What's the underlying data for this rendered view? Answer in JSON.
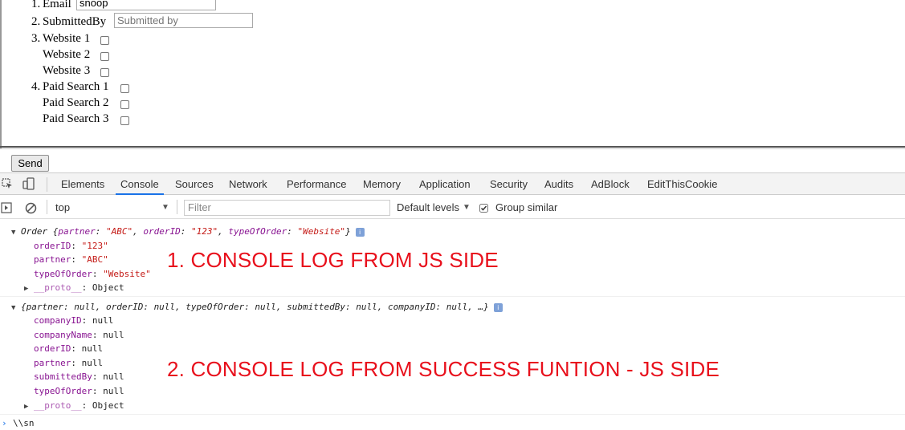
{
  "form": {
    "items": [
      {
        "num": "1.",
        "label": "Email",
        "value": "snoop"
      },
      {
        "num": "2.",
        "label": "SubmittedBy",
        "placeholder": "Submitted by"
      },
      {
        "num": "3.",
        "label": "Website 1"
      },
      {
        "num": "",
        "label": "Website 2"
      },
      {
        "num": "",
        "label": "Website 3"
      },
      {
        "num": "4.",
        "label": "Paid Search 1"
      },
      {
        "num": "",
        "label": "Paid Search 2"
      },
      {
        "num": "",
        "label": "Paid Search 3"
      }
    ],
    "send_label": "Send"
  },
  "devtools": {
    "tabs": [
      "Elements",
      "Console",
      "Sources",
      "Network",
      "Performance",
      "Memory",
      "Application",
      "Security",
      "Audits",
      "AdBlock",
      "EditThisCookie"
    ],
    "active_tab": "Console",
    "toolbar": {
      "context": "top",
      "filter_placeholder": "Filter",
      "levels": "Default levels",
      "group_similar": "Group similar"
    }
  },
  "console": {
    "entry1": {
      "summary_prefix": "Order ",
      "summary_open": "{",
      "summary_pairs": [
        {
          "key": "partner",
          "value": "\"ABC\""
        },
        {
          "key": "orderID",
          "value": "\"123\""
        },
        {
          "key": "typeOfOrder",
          "value": "\"Website\""
        }
      ],
      "summary_close": "}",
      "props": [
        {
          "key": "orderID",
          "value": "\"123\""
        },
        {
          "key": "partner",
          "value": "\"ABC\""
        },
        {
          "key": "typeOfOrder",
          "value": "\"Website\""
        }
      ],
      "proto_key": "__proto__",
      "proto_value": "Object"
    },
    "entry2": {
      "summary": "{partner: null, orderID: null, typeOfOrder: null, submittedBy: null, companyID: null, …}",
      "props": [
        {
          "key": "companyID",
          "value": "null"
        },
        {
          "key": "companyName",
          "value": "null"
        },
        {
          "key": "orderID",
          "value": "null"
        },
        {
          "key": "partner",
          "value": "null"
        },
        {
          "key": "submittedBy",
          "value": "null"
        },
        {
          "key": "typeOfOrder",
          "value": "null"
        }
      ],
      "proto_key": "__proto__",
      "proto_value": "Object"
    },
    "prompt_text": "\\\\sn"
  },
  "annotations": {
    "first": "1. CONSOLE LOG FROM JS SIDE",
    "second": "2. CONSOLE LOG FROM SUCCESS FUNTION - JS SIDE"
  },
  "colors": {
    "annotation": "#e8101c",
    "key": "#881391",
    "string": "#c41a16",
    "active_tab_underline": "#1a73e8"
  }
}
